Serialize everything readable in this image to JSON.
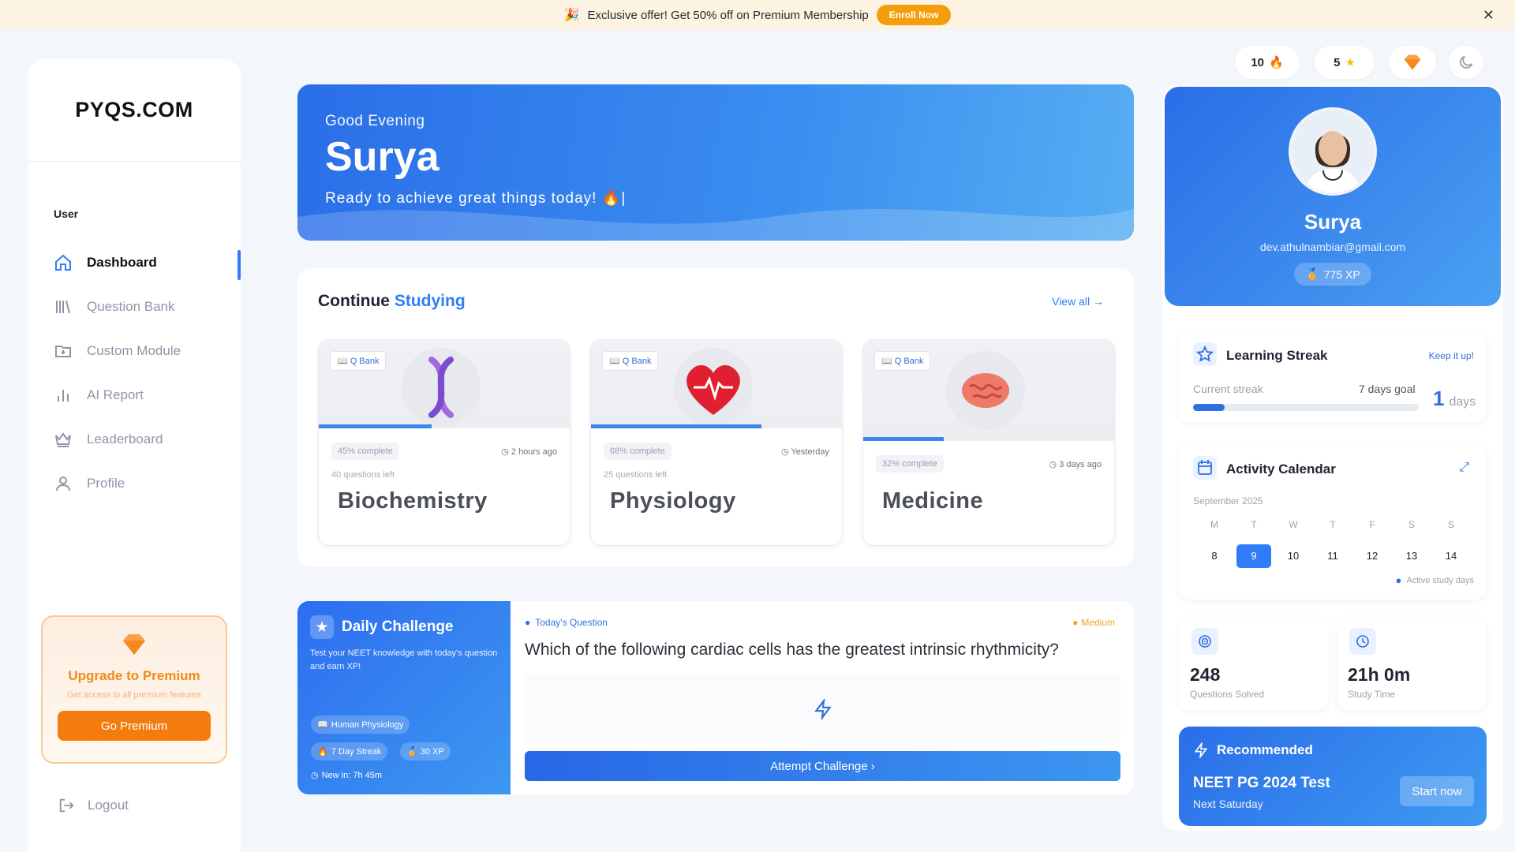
{
  "banner": {
    "text": "Exclusive offer! Get 50% off on Premium Membership",
    "cta": "Enroll Now",
    "close": "✕"
  },
  "sidebar": {
    "logo": "PYQS.COM",
    "section": "User",
    "items": [
      {
        "label": "Dashboard",
        "icon": "home-icon",
        "active": true
      },
      {
        "label": "Question Bank",
        "icon": "library-icon"
      },
      {
        "label": "Custom Module",
        "icon": "folder-plus-icon"
      },
      {
        "label": "AI Report",
        "icon": "bar-chart-icon"
      },
      {
        "label": "Leaderboard",
        "icon": "crown-icon"
      },
      {
        "label": "Profile",
        "icon": "user-icon"
      }
    ],
    "premium": {
      "title": "Upgrade to Premium",
      "subtitle": "Get access to all premium features",
      "button": "Go Premium"
    },
    "logout": "Logout"
  },
  "hero": {
    "greeting": "Good Evening",
    "name": "Surya",
    "tagline": "Ready to achieve great things today! 🔥|"
  },
  "continue": {
    "title_a": "Continue ",
    "title_b": "Studying",
    "view_all": "View all",
    "courses": [
      {
        "tag": "Q Bank",
        "progress_label": "45% complete",
        "progress": 0.45,
        "time": "2 hours ago",
        "left": "40 questions left",
        "name": "Biochemistry",
        "icon": "dna-icon"
      },
      {
        "tag": "Q Bank",
        "progress_label": "68% complete",
        "progress": 0.68,
        "time": "Yesterday",
        "left": "25 questions left",
        "name": "Physiology",
        "icon": "heart-icon"
      },
      {
        "tag": "Q Bank",
        "progress_label": "32% complete",
        "progress": 0.32,
        "time": "3 days ago",
        "left": "",
        "name": "Medicine",
        "icon": "brain-icon"
      }
    ]
  },
  "challenge": {
    "title": "Daily Challenge",
    "desc": "Test your NEET knowledge with today's question and earn XP!",
    "topic": "Human Physiology",
    "streak": "7 Day Streak",
    "xp": "30 XP",
    "new_in": "New in: 7h 45m",
    "today_label": "Today's Question",
    "difficulty": "Medium",
    "question": "Which of the following cardiac cells has the greatest intrinsic rhythmicity?",
    "attempt": "Attempt Challenge"
  },
  "counters": {
    "streak_count": "10",
    "star_count": "5"
  },
  "profile": {
    "name": "Surya",
    "email": "dev.athulnambiar@gmail.com",
    "xp": "775 XP"
  },
  "learning_streak": {
    "title": "Learning Streak",
    "keep": "Keep it up!",
    "current_label": "Current streak",
    "goal_label": "7 days goal",
    "value": "1",
    "unit": "days",
    "progress": 0.14
  },
  "calendar": {
    "title": "Activity Calendar",
    "month": "September 2025",
    "days": [
      {
        "l": "M",
        "n": "8"
      },
      {
        "l": "T",
        "n": "9",
        "today": true
      },
      {
        "l": "W",
        "n": "10"
      },
      {
        "l": "T",
        "n": "11"
      },
      {
        "l": "F",
        "n": "12"
      },
      {
        "l": "S",
        "n": "13"
      },
      {
        "l": "S",
        "n": "14"
      }
    ],
    "legend": "Active study days"
  },
  "stats": {
    "questions_value": "248",
    "questions_label": "Questions Solved",
    "time_value": "21h 0m",
    "time_label": "Study Time"
  },
  "recommended": {
    "heading": "Recommended",
    "title": "NEET PG 2024 Test",
    "sub": "Next Saturday",
    "button": "Start now"
  }
}
